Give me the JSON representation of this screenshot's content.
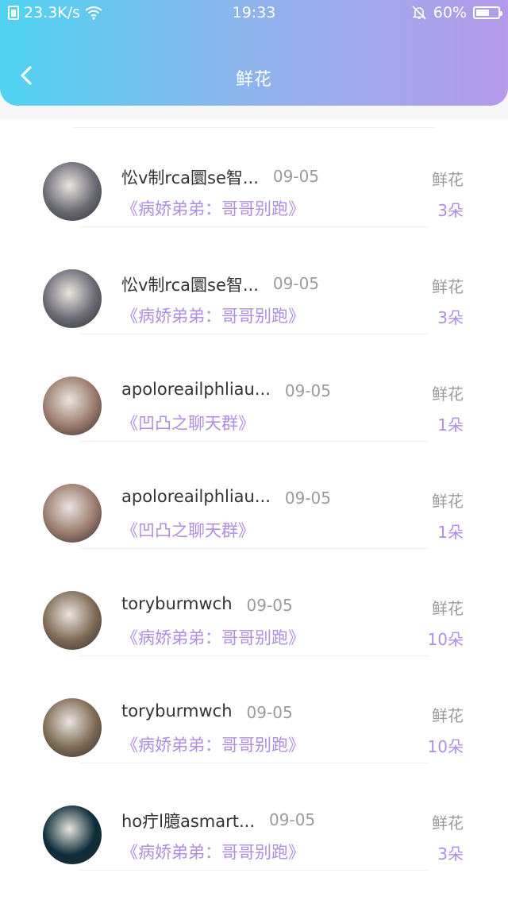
{
  "status_bar": {
    "network_speed": "23.3K/s",
    "time": "19:33",
    "battery_percent": "60%",
    "battery_level": 0.6
  },
  "nav": {
    "title": "鲜花"
  },
  "items": [
    {
      "name": "忪v制rca圜se智...",
      "date": "09-05",
      "book": "《病娇弟弟：哥哥别跑》",
      "type": "鲜花",
      "count": "3朵",
      "avatar_color": "#6a6a75"
    },
    {
      "name": "忪v制rca圜se智...",
      "date": "09-05",
      "book": "《病娇弟弟：哥哥别跑》",
      "type": "鲜花",
      "count": "3朵",
      "avatar_color": "#6a6a75"
    },
    {
      "name": "apoloreailphliau...",
      "date": "09-05",
      "book": "《凹凸之聊天群》",
      "type": "鲜花",
      "count": "1朵",
      "avatar_color": "#9a7a6c"
    },
    {
      "name": "apoloreailphliau...",
      "date": "09-05",
      "book": "《凹凸之聊天群》",
      "type": "鲜花",
      "count": "1朵",
      "avatar_color": "#9a7a6c"
    },
    {
      "name": "toryburmwch",
      "date": "09-05",
      "book": "《病娇弟弟：哥哥别跑》",
      "type": "鲜花",
      "count": "10朵",
      "avatar_color": "#7e6a55"
    },
    {
      "name": "toryburmwch",
      "date": "09-05",
      "book": "《病娇弟弟：哥哥别跑》",
      "type": "鲜花",
      "count": "10朵",
      "avatar_color": "#7e6a55"
    },
    {
      "name": "ho疔l臆asmart...",
      "date": "09-05",
      "book": "《病娇弟弟：哥哥别跑》",
      "type": "鲜花",
      "count": "3朵",
      "avatar_color": "#0d2d3a"
    }
  ]
}
